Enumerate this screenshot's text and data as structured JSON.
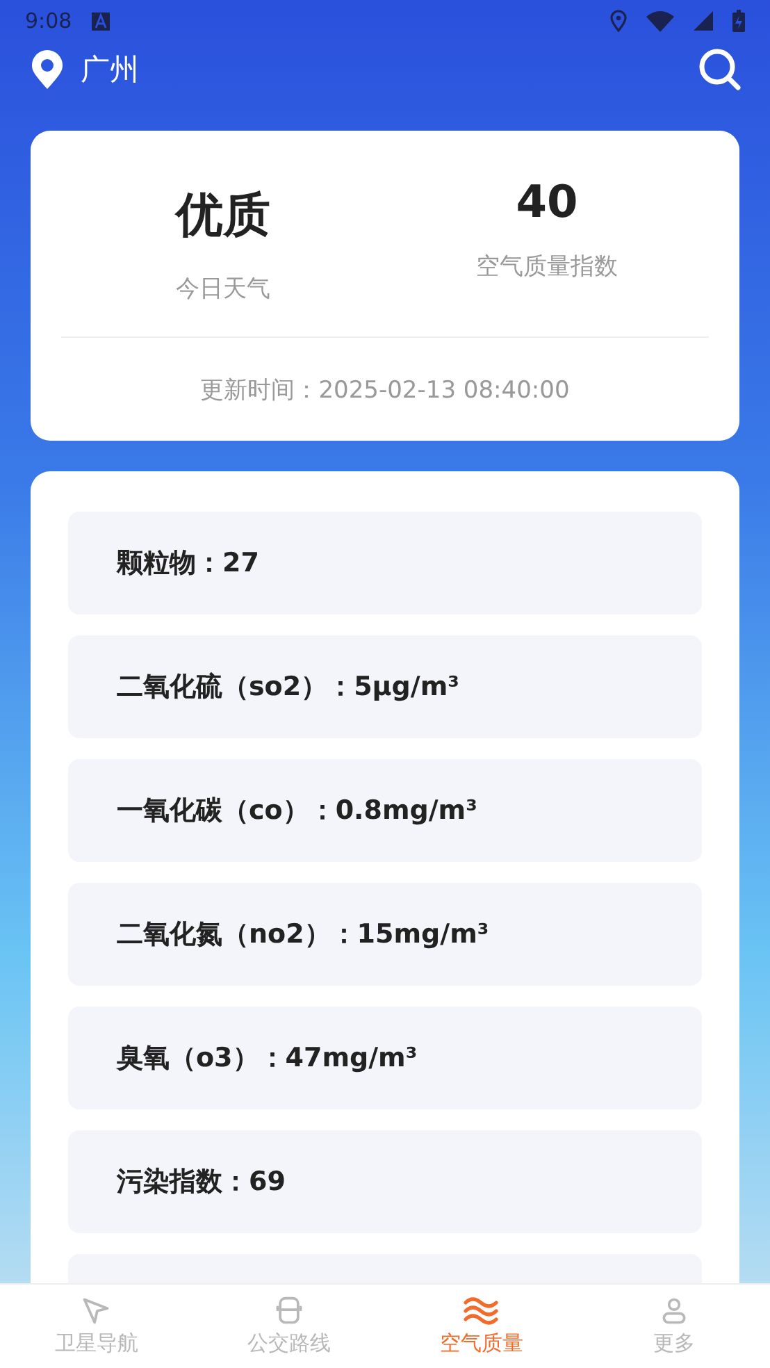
{
  "status_bar": {
    "time": "9:08"
  },
  "header": {
    "city": "广州"
  },
  "summary": {
    "quality": "优质",
    "quality_label": "今日天气",
    "aqi": "40",
    "aqi_label": "空气质量指数",
    "updated": "更新时间：2025-02-13 08:40:00"
  },
  "pollutants": [
    {
      "text": "颗粒物：27"
    },
    {
      "text": "二氧化硫（so2）：5μg/m³"
    },
    {
      "text": "一氧化碳（co）：0.8mg/m³"
    },
    {
      "text": "二氧化氮（no2）：15mg/m³"
    },
    {
      "text": "臭氧（o3）：47mg/m³"
    },
    {
      "text": "污染指数：69"
    }
  ],
  "tab_bar": [
    {
      "kind": "navigate",
      "label": "卫星导航",
      "selected": false
    },
    {
      "kind": "bus",
      "label": "公交路线",
      "selected": false
    },
    {
      "kind": "air",
      "label": "空气质量",
      "selected": true
    },
    {
      "kind": "more",
      "label": "更多",
      "selected": false
    }
  ]
}
